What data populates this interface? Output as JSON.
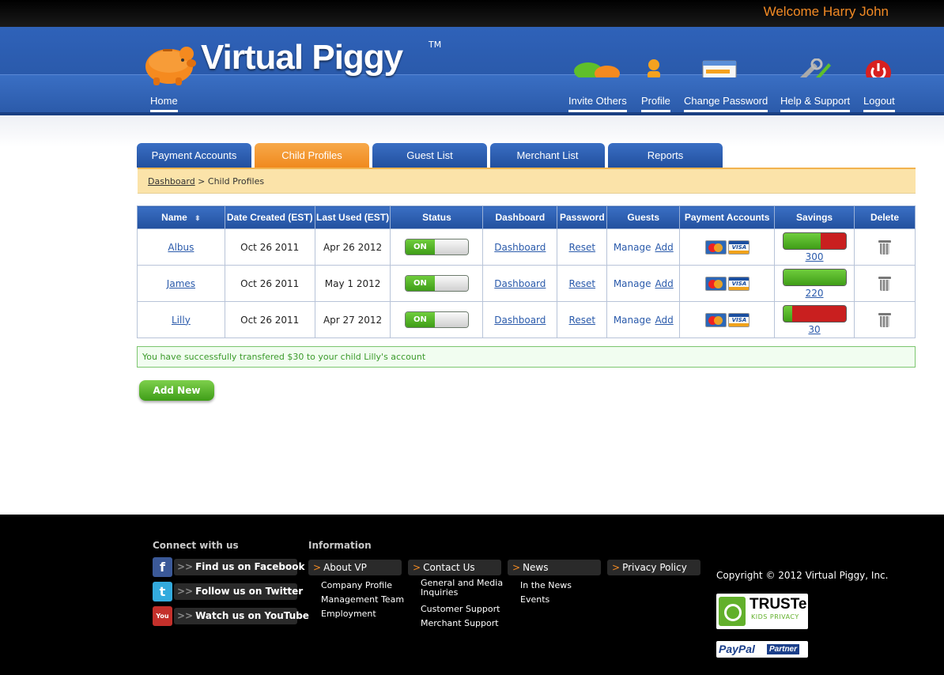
{
  "welcome": "Welcome Harry John",
  "logo": {
    "brand": "Virtual Piggy",
    "tm": "TM"
  },
  "nav": {
    "home": "Home",
    "invite": "Invite Others",
    "profile": "Profile",
    "change_password": "Change Password",
    "help": "Help & Support",
    "logout": "Logout"
  },
  "header_icons": [
    "chat-bubbles-icon",
    "person-icon",
    "password-card-icon",
    "tools-icon",
    "power-icon"
  ],
  "tabs": [
    {
      "label": "Payment Accounts",
      "active": false
    },
    {
      "label": "Child Profiles",
      "active": true
    },
    {
      "label": "Guest List",
      "active": false
    },
    {
      "label": "Merchant List",
      "active": false
    },
    {
      "label": "Reports",
      "active": false
    }
  ],
  "breadcrumb": {
    "link": "Dashboard",
    "separator": " > ",
    "current": "Child Profiles"
  },
  "table": {
    "headers": [
      "Name",
      "Date Created (EST)",
      "Last Used (EST)",
      "Status",
      "Dashboard",
      "Password",
      "Guests",
      "Payment Accounts",
      "Savings",
      "Delete"
    ],
    "rows": [
      {
        "name": "Albus",
        "created": "Oct 26 2011",
        "last_used": "Apr 26 2012",
        "status": "ON",
        "dashboard": "Dashboard",
        "password": "Reset",
        "manage": "Manage",
        "add": "Add",
        "savings": "300",
        "savings_progress": 0.6
      },
      {
        "name": "James",
        "created": "Oct 26 2011",
        "last_used": "May 1 2012",
        "status": "ON",
        "dashboard": "Dashboard",
        "password": "Reset",
        "manage": "Manage",
        "add": "Add",
        "savings": "220",
        "savings_progress": 1.0
      },
      {
        "name": "Lilly",
        "created": "Oct 26 2011",
        "last_used": "Apr 27 2012",
        "status": "ON",
        "dashboard": "Dashboard",
        "password": "Reset",
        "manage": "Manage",
        "add": "Add",
        "savings": "30",
        "savings_progress": 0.15
      }
    ],
    "card_labels": {
      "visa": "VISA"
    }
  },
  "success_message": "You have successfully transfered $30 to your child Lilly's account",
  "add_new": "Add New",
  "footer": {
    "connect_heading": "Connect with us",
    "social": [
      {
        "label": "Find us on Facebook",
        "arrow": ">>",
        "icon_char": "f",
        "color": "#3b5998"
      },
      {
        "label": "Follow us on Twitter",
        "arrow": ">>",
        "icon_char": "t",
        "color": "#33aadd"
      },
      {
        "label": "Watch us on YouTube",
        "arrow": ">>",
        "icon_char": "You",
        "color": "#c4302b"
      }
    ],
    "info_heading": "Information",
    "info": [
      {
        "title": "About VP",
        "links": [
          "Company Profile",
          "Management Team",
          "Employment"
        ]
      },
      {
        "title": "Contact Us",
        "links": [
          "General and Media Inquiries",
          "Customer Support",
          "Merchant Support"
        ]
      },
      {
        "title": "News",
        "links": [
          "In the News",
          "Events"
        ]
      },
      {
        "title": "Privacy Policy",
        "links": []
      }
    ],
    "copyright": "Copyright © 2012 Virtual Piggy, Inc.",
    "truste": {
      "title": "TRUSTe",
      "subtitle": "KIDS PRIVACY"
    },
    "paypal": {
      "brand": "PayPal",
      "partner": "Partner"
    }
  },
  "colors": {
    "accent_orange": "#f28a24",
    "nav_blue": "#2a5aab",
    "success_green": "#3b9a2b",
    "toggle_green": "#3f9d18",
    "savings_red": "#c91f1f"
  }
}
